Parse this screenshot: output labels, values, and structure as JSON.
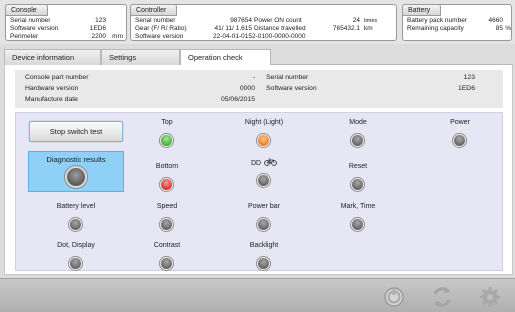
{
  "console": {
    "title": "Console",
    "rows": [
      {
        "label": "Serial number",
        "value": "123",
        "unit": ""
      },
      {
        "label": "Software version",
        "value": "1ED6",
        "unit": ""
      },
      {
        "label": "Perimeter",
        "value": "2200",
        "unit": "mm"
      }
    ]
  },
  "controller": {
    "title": "Controller",
    "rows": [
      {
        "label": "Serial number",
        "value": "987654"
      },
      {
        "label": "Gear (F/ R/ Ratio)",
        "value": "41/ 11/ 1.615"
      },
      {
        "label": "Software version",
        "value": "22-04-01-0152-0100-0000-0000"
      }
    ],
    "rows2": [
      {
        "label": "Power ON count",
        "value": "24",
        "unit": "times"
      },
      {
        "label": "Distance travelled",
        "value": "765432.1",
        "unit": "km"
      }
    ]
  },
  "battery": {
    "title": "Battery",
    "rows": [
      {
        "label": "Battery pack number",
        "value": "4660",
        "unit": ""
      },
      {
        "label": "Remaining capacity",
        "value": "85",
        "unit": "%"
      }
    ]
  },
  "tabs": [
    {
      "label": "Device information"
    },
    {
      "label": "Settings"
    },
    {
      "label": "Operation check"
    }
  ],
  "info": {
    "left": [
      {
        "label": "Console part number",
        "value": "-"
      },
      {
        "label": "Hardware version",
        "value": "0000"
      },
      {
        "label": "Manufacture date",
        "value": "05/06/2015"
      }
    ],
    "right": [
      {
        "label": "Serial number",
        "value": "123"
      },
      {
        "label": "Software version",
        "value": "1ED6"
      }
    ]
  },
  "switch_test": {
    "button_label": "Stop switch test",
    "diagnostic_label": "Diagnostic results",
    "diagnostic_state": "off",
    "indicators": [
      {
        "label": "Top",
        "state": "green"
      },
      {
        "label": "Night (Light)",
        "state": "orange"
      },
      {
        "label": "Mode",
        "state": "off"
      },
      {
        "label": "Power",
        "state": "off"
      },
      {
        "label": "Bottom",
        "state": "red"
      },
      {
        "label": "DD",
        "icon": "bicycle-icon",
        "state": "off"
      },
      {
        "label": "Reset",
        "state": "off"
      },
      {
        "label": "Battery level",
        "state": "off"
      },
      {
        "label": "Speed",
        "state": "off"
      },
      {
        "label": "Power bar",
        "state": "off"
      },
      {
        "label": "Mark, Time",
        "state": "off"
      },
      {
        "label": "Dot, Display",
        "state": "off"
      },
      {
        "label": "Contrast",
        "state": "off"
      },
      {
        "label": "Backlight",
        "state": "off"
      }
    ]
  },
  "toolbar": {
    "icons": [
      "disconnect-icon",
      "refresh-icon",
      "settings-gear-icon"
    ]
  }
}
